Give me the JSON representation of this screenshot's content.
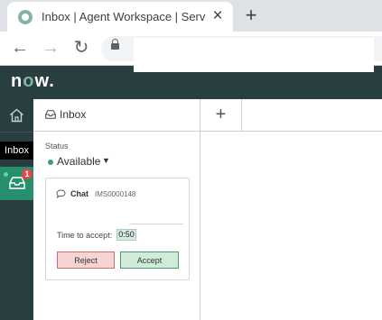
{
  "browser": {
    "tab_title": "Inbox | Agent Workspace | ServiceNow",
    "tab_close_icon": "×",
    "new_tab_icon": "+",
    "back_icon": "←",
    "forward_icon": "→",
    "reload_icon": "↻"
  },
  "app": {
    "logo_prefix": "n",
    "logo_accent": "o",
    "logo_suffix": "w.",
    "header_color": "#293e40",
    "accent_color": "#81b5a1"
  },
  "rail": {
    "tooltip": "Inbox",
    "inbox_badge": "1",
    "active_color": "#278f6d"
  },
  "workspace": {
    "inbox_tab_label": "Inbox",
    "add_tab_icon": "+"
  },
  "inbox": {
    "status_label": "Status",
    "status_value": "Available",
    "status_caret": "▼",
    "card": {
      "channel": "Chat",
      "record_id": "IMS0000148",
      "time_label": "Time to accept:",
      "time_value": "0:50",
      "reject_label": "Reject",
      "accept_label": "Accept"
    }
  }
}
